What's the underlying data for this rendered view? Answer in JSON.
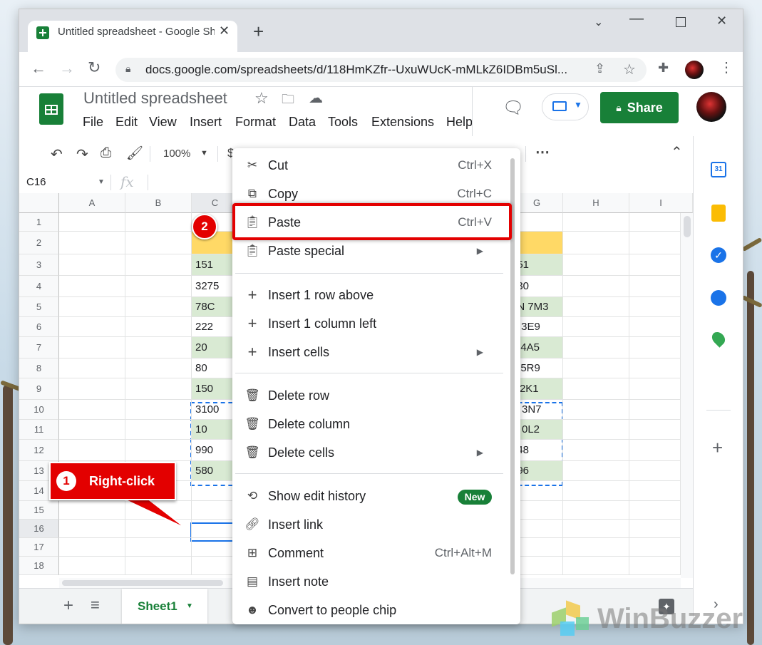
{
  "browser": {
    "tab_title": "Untitled spreadsheet - Google Sh",
    "url": "docs.google.com/spreadsheets/d/118HmKZfr--UxuWUcK-mMLkZ6IDBm5uSl..."
  },
  "sheets_header": {
    "doc_title": "Untitled spreadsheet",
    "menu": [
      "File",
      "Edit",
      "View",
      "Insert",
      "Format",
      "Data",
      "Tools",
      "Extensions",
      "Help"
    ],
    "share_label": "Share"
  },
  "toolbar": {
    "zoom": "100%"
  },
  "formula_bar": {
    "name_box": "C16",
    "fx": "fx"
  },
  "grid": {
    "columns": [
      "A",
      "B",
      "C",
      "G",
      "H",
      "I"
    ],
    "rows": [
      "1",
      "2",
      "3",
      "4",
      "5",
      "6",
      "7",
      "8",
      "9",
      "10",
      "11",
      "12",
      "13",
      "14",
      "15",
      "16",
      "17",
      "18"
    ],
    "column_c": [
      "151",
      "3275",
      "78C",
      "222",
      "20",
      "80",
      "150",
      "3100",
      "10",
      "990",
      "580"
    ],
    "column_g": [
      "951",
      "630",
      "3N 7M3",
      "S 3E9",
      "Z 4A5",
      "A 5R9",
      "L 2K1",
      "R 3N7",
      "R 0L2",
      "248",
      "296"
    ]
  },
  "context_menu": {
    "items": [
      {
        "icon": "scissors-icon",
        "label": "Cut",
        "shortcut": "Ctrl+X"
      },
      {
        "icon": "copy-icon",
        "label": "Copy",
        "shortcut": "Ctrl+C"
      },
      {
        "icon": "clipboard-icon",
        "label": "Paste",
        "shortcut": "Ctrl+V"
      },
      {
        "icon": "clipboard-icon",
        "label": "Paste special",
        "shortcut": ""
      },
      {
        "icon": "plus-icon",
        "label": "Insert 1 row above",
        "shortcut": ""
      },
      {
        "icon": "plus-icon",
        "label": "Insert 1 column left",
        "shortcut": ""
      },
      {
        "icon": "plus-icon",
        "label": "Insert cells",
        "shortcut": ""
      },
      {
        "icon": "trash-icon",
        "label": "Delete row",
        "shortcut": ""
      },
      {
        "icon": "trash-icon",
        "label": "Delete column",
        "shortcut": ""
      },
      {
        "icon": "trash-icon",
        "label": "Delete cells",
        "shortcut": ""
      },
      {
        "icon": "history-icon",
        "label": "Show edit history",
        "shortcut": ""
      },
      {
        "icon": "link-icon",
        "label": "Insert link",
        "shortcut": ""
      },
      {
        "icon": "comment-icon",
        "label": "Comment",
        "shortcut": "Ctrl+Alt+M"
      },
      {
        "icon": "note-icon",
        "label": "Insert note",
        "shortcut": ""
      },
      {
        "icon": "person-chip-icon",
        "label": "Convert to people chip",
        "shortcut": ""
      }
    ],
    "new_badge": "New"
  },
  "annotations": {
    "step1_number": "1",
    "step1_label": "Right-click",
    "step2_number": "2"
  },
  "sheet_tab": "Sheet1",
  "watermark": "WinBuzzer",
  "colors": {
    "sheets_green": "#188038",
    "header_yellow": "#ffd966",
    "light_green": "#d9ead3",
    "callout_red": "#e30000",
    "selection_blue": "#1a73e8"
  }
}
